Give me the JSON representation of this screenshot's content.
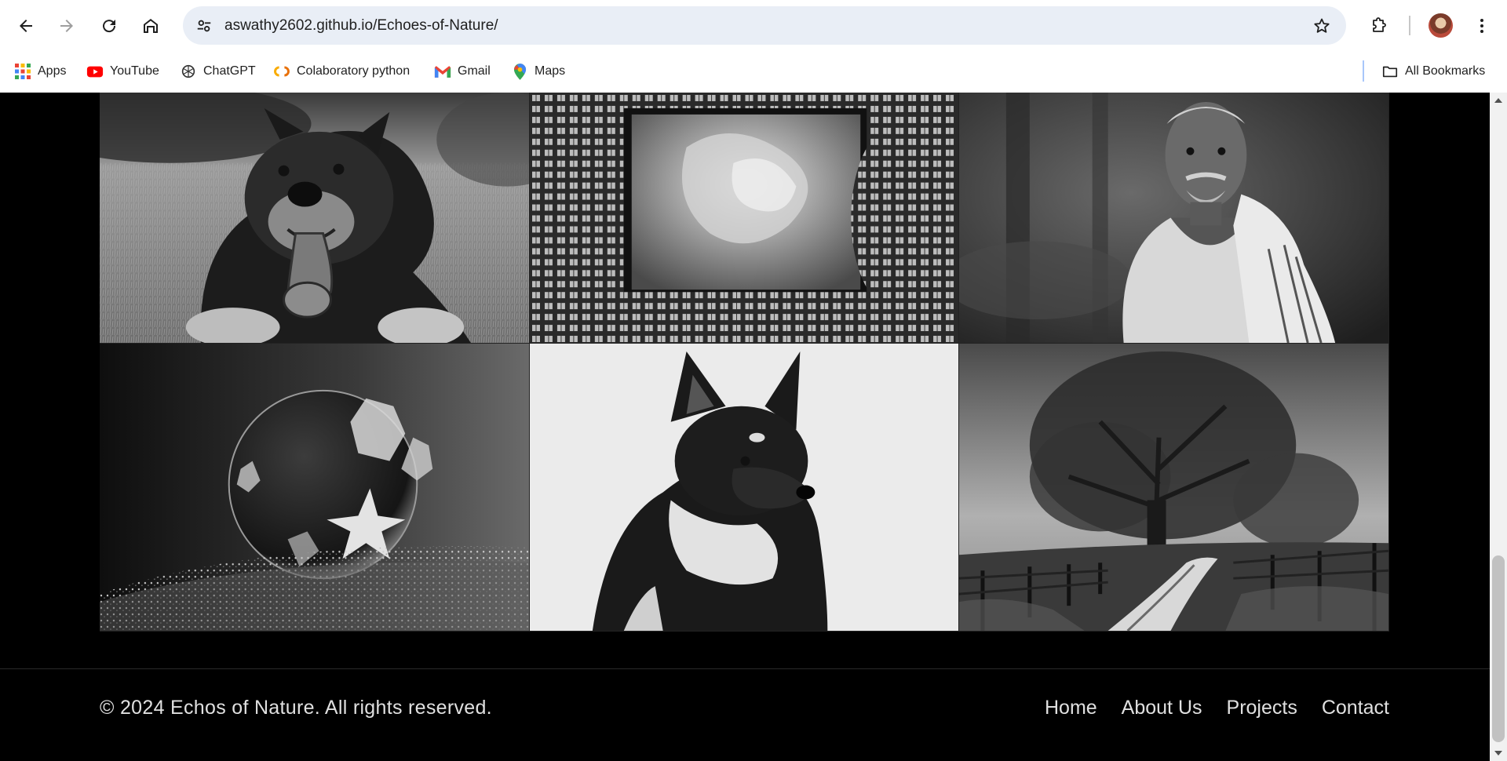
{
  "browser": {
    "url": "aswathy2602.github.io/Echoes-of-Nature/",
    "bookmarks": [
      {
        "label": "Apps",
        "icon": "apps-grid-icon"
      },
      {
        "label": "YouTube",
        "icon": "youtube-icon"
      },
      {
        "label": "ChatGPT",
        "icon": "chatgpt-icon"
      },
      {
        "label": "Colaboratory python",
        "icon": "colab-icon"
      },
      {
        "label": "Gmail",
        "icon": "gmail-icon"
      },
      {
        "label": "Maps",
        "icon": "maps-icon"
      }
    ],
    "all_bookmarks_label": "All Bookmarks"
  },
  "gallery": {
    "images": [
      {
        "subject": "smiling dog lying in grass",
        "icon": "dog-photo"
      },
      {
        "subject": "courtyard buildings looking up at cloudy sky",
        "icon": "building-photo"
      },
      {
        "subject": "elderly man with towel on shoulder",
        "icon": "portrait-photo"
      },
      {
        "subject": "frozen bubble with frost crystals",
        "icon": "bubble-photo"
      },
      {
        "subject": "husky dog portrait",
        "icon": "husky-photo"
      },
      {
        "subject": "large tree beside country path and fence",
        "icon": "tree-photo"
      }
    ]
  },
  "footer": {
    "copyright": "© 2024 Echos of Nature. All rights reserved.",
    "nav": [
      "Home",
      "About Us",
      "Projects",
      "Contact"
    ]
  },
  "colors": {
    "page_bg": "#000000",
    "footer_text": "#e0e0e0",
    "omnibox_bg": "#e9eef6"
  }
}
